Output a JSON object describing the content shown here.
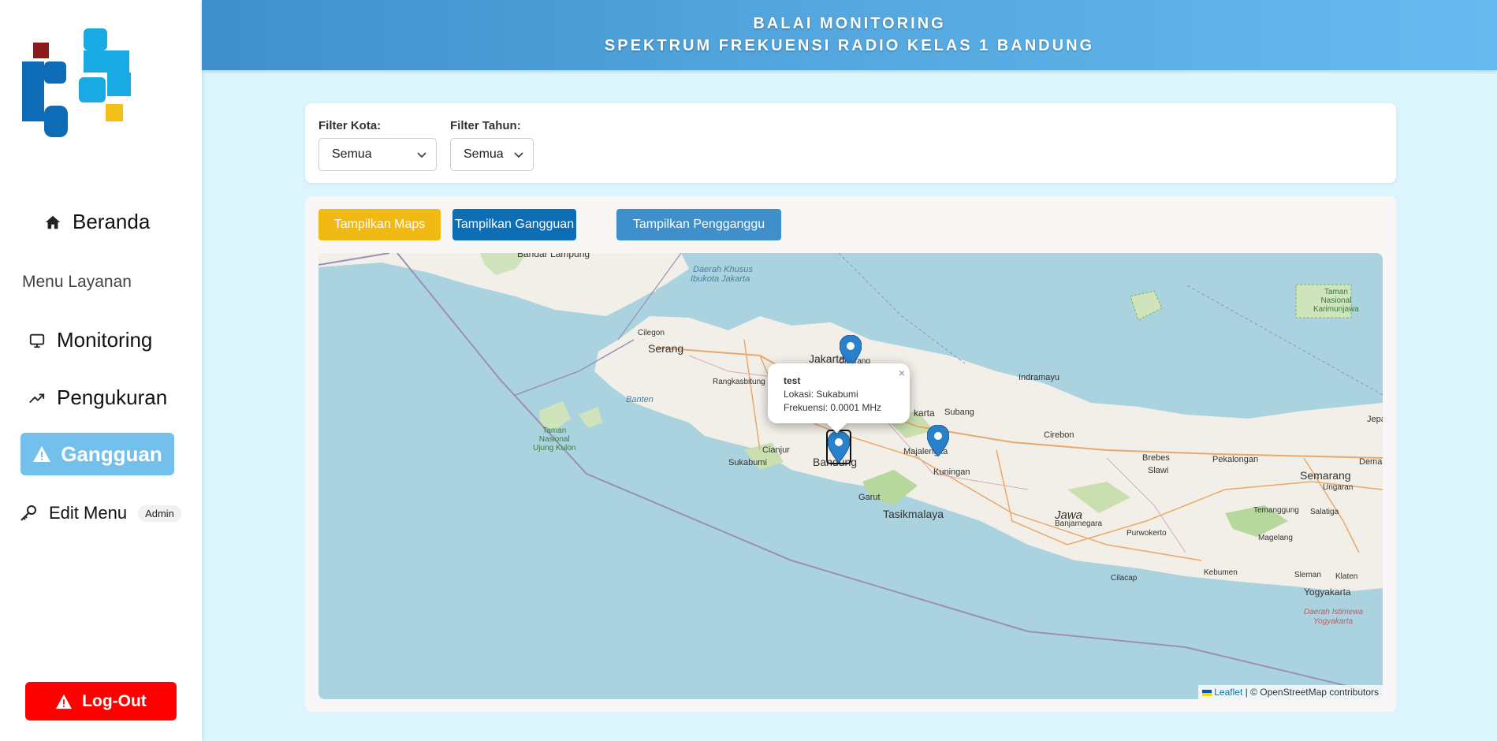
{
  "header": {
    "line1": "BALAI MONITORING",
    "line2": "SPEKTRUM FREKUENSI RADIO KELAS 1 BANDUNG"
  },
  "sidebar": {
    "home_label": "Beranda",
    "menu_heading": "Menu Layanan",
    "monitoring_label": "Monitoring",
    "pengukuran_label": "Pengukuran",
    "gangguan_label": "Gangguan",
    "edit_menu_label": "Edit Menu",
    "admin_badge": "Admin",
    "logout_label": "Log-Out"
  },
  "filters": {
    "kota_label": "Filter Kota:",
    "kota_value": "Semua",
    "tahun_label": "Filter Tahun:",
    "tahun_value": "Semua"
  },
  "buttons": {
    "maps": "Tampilkan Maps",
    "gangguan": "Tampilkan Gangguan",
    "pengganggu": "Tampilkan Pengganggu"
  },
  "popup": {
    "title": "test",
    "lokasi": "Lokasi: Sukabumi",
    "frekuensi": "Frekuensi: 0.0001 MHz",
    "close": "×"
  },
  "attribution": {
    "leaflet": "Leaflet",
    "rest": "| © OpenStreetMap contributors"
  },
  "map_labels": {
    "bandar_lampung": "Bandar Lampung",
    "daerah_khusus": "Daerah Khusus",
    "ibukota_jakarta": "Ibukota Jakarta",
    "taman_karimunjawa_1": "Taman",
    "taman_karimunjawa_2": "Nasional",
    "taman_karimunjawa_3": "Karimunjawa",
    "cilegon": "Cilegon",
    "serang": "Serang",
    "jakarta": "Jakarta",
    "cikarang": "Cikarang",
    "rangkasbitung": "Rangkasbitung",
    "banten": "Banten",
    "indramayu": "Indramayu",
    "karta": "karta",
    "subang": "Subang",
    "taman_ujung_1": "Taman",
    "taman_ujung_2": "Nasional",
    "taman_ujung_3": "Ujung Kulon",
    "cirebon": "Cirebon",
    "brebes": "Brebes",
    "pekalongan": "Pekalongan",
    "semarang": "Semarang",
    "jepa": "Jepa",
    "demak": "Demal",
    "cianjur": "Cianjur",
    "sukabumi": "Sukabumi",
    "bandung": "Bandung",
    "majalengka": "Majalengka",
    "kuningan": "Kuningan",
    "slawi": "Slawi",
    "ungaran": "Ungaran",
    "garut": "Garut",
    "tasikmalaya": "Tasikmalaya",
    "jawa": "Jawa",
    "banjarnegara": "Banjarnegara",
    "temanggung": "Temanggung",
    "salatiga": "Salatiga",
    "purwokerto": "Purwokerto",
    "magelang": "Magelang",
    "cilacap": "Cilacap",
    "kebumen": "Kebumen",
    "sleman": "Sleman",
    "klaten": "Klaten",
    "yogyakarta": "Yogyakarta",
    "diy_1": "Daerah Istimewa",
    "diy_2": "Yogyakarta"
  },
  "colors": {
    "header_start": "#3f8fcb",
    "header_end": "#66baef",
    "page_bg": "#dcf5fc",
    "btn_maps": "#f0b913",
    "btn_gangguan": "#0d6db5",
    "btn_pengganggu": "#3e8fca",
    "sidebar_active": "#74c0ed",
    "logout": "#ff0000",
    "sea": "#aad3df",
    "land": "#f2efe9"
  }
}
